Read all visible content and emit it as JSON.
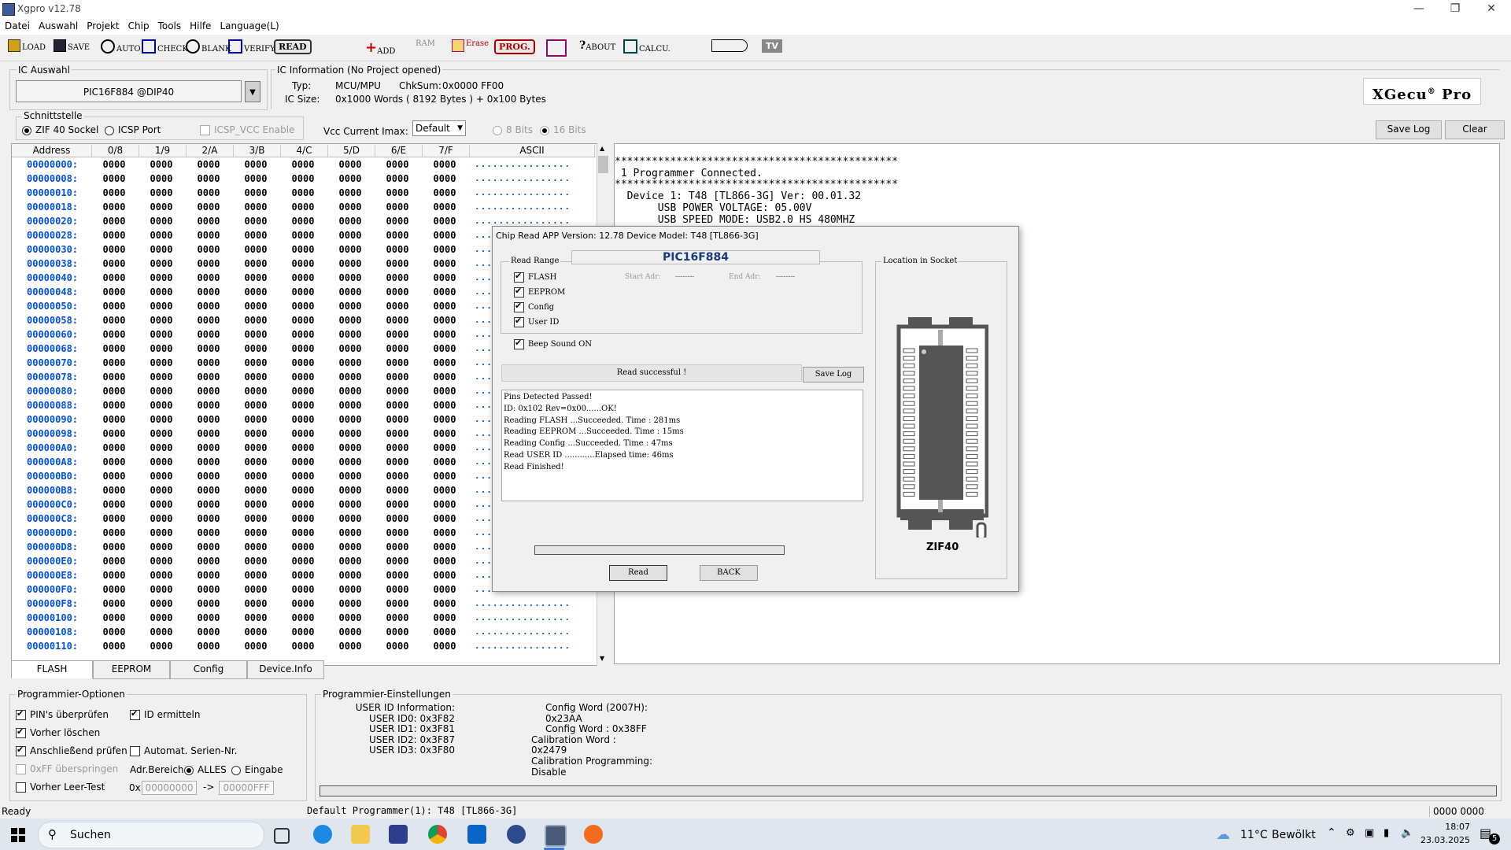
{
  "window": {
    "title": "Xgpro v12.78",
    "min": "—",
    "restore": "❐",
    "close": "✕"
  },
  "menu": [
    "Datei",
    "Auswahl",
    "Projekt",
    "Chip",
    "Tools",
    "Hilfe",
    "Language(L)"
  ],
  "toolbar": {
    "load": "LOAD",
    "save": "SAVE",
    "auto": "AUTO",
    "check": "CHECK",
    "blank": "BLANK",
    "verify": "VERIFY",
    "read": "READ",
    "add": "ADD",
    "ram": "RAM",
    "erase": "Erase",
    "prog": "PROG.",
    "about": "ABOUT",
    "calcu": "CALCU.",
    "tv": "TV"
  },
  "ic_auswahl": {
    "label": "IC Auswahl",
    "value": "PIC16F884 @DIP40"
  },
  "ic_info": {
    "label": "IC Information (No Project opened)",
    "typ_label": "Typ:",
    "typ_value": "MCU/MPU",
    "chksum_label": "ChkSum:",
    "chksum_value": "0x0000 FF00",
    "size_label": "IC Size:",
    "size_value": "0x1000 Words ( 8192 Bytes ) + 0x100 Bytes"
  },
  "logo": {
    "text": "XGecu",
    "reg": "®",
    "suffix": "Pro"
  },
  "schnittstelle": {
    "label": "Schnittstelle",
    "zif": "ZIF 40 Sockel",
    "icsp": "ICSP Port",
    "icsp_vcc": "ICSP_VCC Enable",
    "vcc_label": "Vcc Current Imax:",
    "vcc_value": "Default",
    "bits8": "8 Bits",
    "bits16": "16 Bits"
  },
  "log_buttons": {
    "save_log": "Save Log",
    "clear": "Clear"
  },
  "hex": {
    "headers": [
      "Address",
      "0/8",
      "1/9",
      "2/A",
      "3/B",
      "4/C",
      "5/D",
      "6/E",
      "7/F",
      "ASCII"
    ],
    "cell": "0000",
    "ascii": "................",
    "addresses": [
      "00000000:",
      "00000008:",
      "00000010:",
      "00000018:",
      "00000020:",
      "00000028:",
      "00000030:",
      "00000038:",
      "00000040:",
      "00000048:",
      "00000050:",
      "00000058:",
      "00000060:",
      "00000068:",
      "00000070:",
      "00000078:",
      "00000080:",
      "00000088:",
      "00000090:",
      "00000098:",
      "000000A0:",
      "000000A8:",
      "000000B0:",
      "000000B8:",
      "000000C0:",
      "000000C8:",
      "000000D0:",
      "000000D8:",
      "000000E0:",
      "000000E8:",
      "000000F0:",
      "000000F8:",
      "00000100:",
      "00000108:",
      "00000110:"
    ]
  },
  "tabs": [
    "FLASH",
    "EEPROM",
    "Config",
    "Device.Info"
  ],
  "log_text": "**********************************************\n 1 Programmer Connected.\n**********************************************\n  Device 1: T48 [TL866-3G] Ver: 00.01.32\n       USB POWER VOLTAGE: 05.00V\n       USB SPEED MODE: USB2.0 HS 480MHZ",
  "dialog": {
    "title": "Chip Read   APP Version: 12.78 Device Model: T48 [TL866-3G]",
    "chip": "PIC16F884",
    "read_range": "Read Range",
    "flash": "FLASH",
    "eeprom": "EEPROM",
    "config": "Config",
    "user_id": "User ID",
    "start_adr": "Start Adr:",
    "start_val": "--------",
    "end_adr": "End Adr:",
    "end_val": "--------",
    "beep": "Beep Sound ON",
    "status": "Read successful !",
    "save_log": "Save Log",
    "log": [
      "Pins Detected Passed!",
      "ID: 0x102 Rev=0x00......OK!",
      "Reading FLASH ...Succeeded. Time : 281ms",
      "Reading EEPROM ...Succeeded. Time : 15ms",
      "Reading Config ...Succeeded. Time : 47ms",
      "Read USER ID ............Elapsed time: 46ms",
      "Read Finished!"
    ],
    "read_btn": "Read",
    "back_btn": "BACK",
    "location": "Location in Socket",
    "zif": "ZIF40"
  },
  "prog_optionen": {
    "label": "Programmier-Optionen",
    "pin": "PIN's überprüfen",
    "id": "ID ermitteln",
    "vorher_loeschen": "Vorher löschen",
    "anschl": "Anschließend prüfen",
    "serien": "Automat. Serien-Nr.",
    "ff": "0xFF überspringen",
    "adr": "Adr.Bereich",
    "alles": "ALLES",
    "eingabe": "Eingabe",
    "leer": "Vorher Leer-Test",
    "ox": "0x",
    "from": "00000000",
    "arrow": "->",
    "to": "00000FFF"
  },
  "prog_einst": {
    "label": "Programmier-Einstellungen",
    "left": [
      "USER ID Information:",
      "USER ID0: 0x3F82",
      "USER ID1: 0x3F81",
      "USER ID2: 0x3F87",
      "USER ID3: 0x3F80"
    ],
    "right": [
      "Config Word (2007H): 0x23AA",
      "Config Word : 0x38FF",
      "Calibration Word : 0x2479",
      "Calibration Programming: Disable"
    ]
  },
  "statusbar": {
    "ready": "Ready",
    "programmer": "Default Programmer(1): T48 [TL866-3G]",
    "code": "0000 0000"
  },
  "taskbar": {
    "search": "Suchen",
    "weather_temp": "11°C",
    "weather_text": "Bewölkt",
    "time": "18:07",
    "date": "23.03.2025",
    "notif": "5"
  }
}
